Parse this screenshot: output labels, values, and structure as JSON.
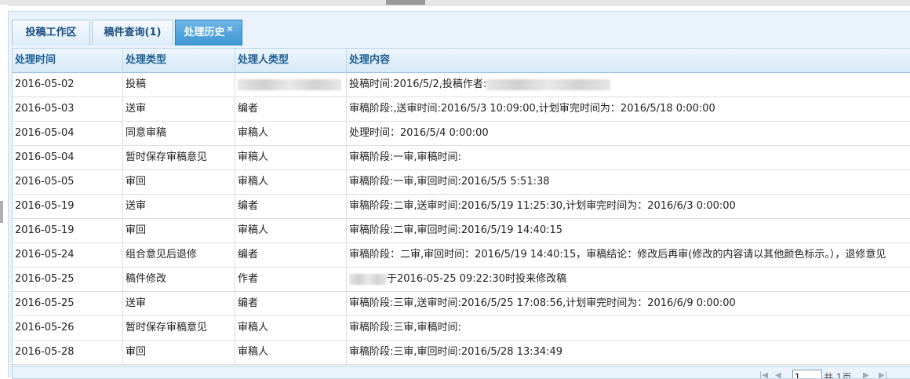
{
  "tabs": [
    {
      "label": "投稿工作区"
    },
    {
      "label": "稿件查询(1)"
    },
    {
      "label": "处理历史",
      "close": "×"
    }
  ],
  "columns": [
    "处理时间",
    "处理类型",
    "处理人类型",
    "处理内容"
  ],
  "rows": [
    {
      "time": "2016-05-02",
      "type": "投稿",
      "actor": "",
      "content": "投稿时间:2016/5/2,投稿作者:"
    },
    {
      "time": "2016-05-03",
      "type": "送审",
      "actor": "编者",
      "content": "审稿阶段:,送审时间:2016/5/3 10:09:00,计划审完时间为：2016/5/18 0:00:00"
    },
    {
      "time": "2016-05-04",
      "type": "同意审稿",
      "actor": "审稿人",
      "content": "处理时间：2016/5/4 0:00:00"
    },
    {
      "time": "2016-05-04",
      "type": "暂时保存审稿意见",
      "actor": "审稿人",
      "content": "审稿阶段:一审,审稿时间:"
    },
    {
      "time": "2016-05-05",
      "type": "审回",
      "actor": "审稿人",
      "content": "审稿阶段:一审,审回时间:2016/5/5 5:51:38"
    },
    {
      "time": "2016-05-19",
      "type": "送审",
      "actor": "编者",
      "content": "审稿阶段:二审,送审时间:2016/5/19 11:25:30,计划审完时间为：2016/6/3 0:00:00"
    },
    {
      "time": "2016-05-19",
      "type": "审回",
      "actor": "审稿人",
      "content": "审稿阶段:二审,审回时间:2016/5/19 14:40:15"
    },
    {
      "time": "2016-05-24",
      "type": "组合意见后退修",
      "actor": "编者",
      "content": "审稿阶段：二审,审回时间：2016/5/19 14:40:15，审稿结论：修改后再审(修改的内容请以其他颜色标示。），退修意见"
    },
    {
      "time": "2016-05-25",
      "type": "稿件修改",
      "actor": "作者",
      "content": "于2016-05-25 09:22:30时投来修改稿"
    },
    {
      "time": "2016-05-25",
      "type": "送审",
      "actor": "编者",
      "content": "审稿阶段:三审,送审时间:2016/5/25 17:08:56,计划审完时间为：2016/6/9 0:00:00"
    },
    {
      "time": "2016-05-26",
      "type": "暂时保存审稿意见",
      "actor": "审稿人",
      "content": "审稿阶段:三审,审稿时间:"
    },
    {
      "time": "2016-05-28",
      "type": "审回",
      "actor": "审稿人",
      "content": "审稿阶段:三审,审回时间:2016/5/28 13:34:49"
    }
  ],
  "pager": {
    "page": "1",
    "total_prefix": "共",
    "total": "1页"
  }
}
